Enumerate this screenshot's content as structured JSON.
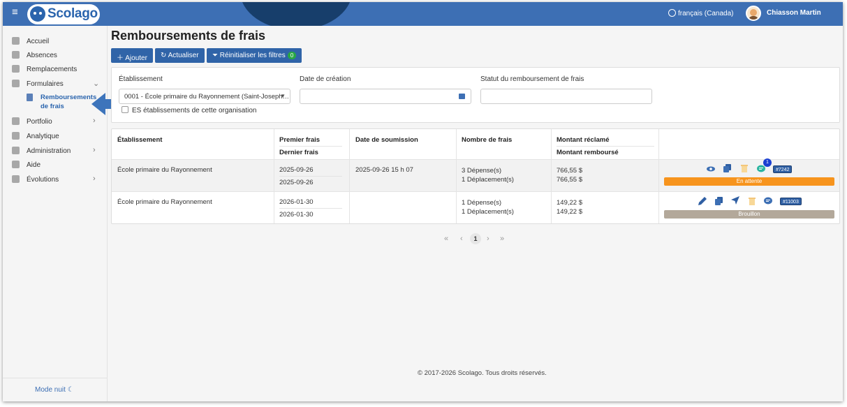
{
  "app": {
    "logo_text": "Scolago",
    "language": "français (Canada)",
    "user_name": "Chiasson Martin"
  },
  "sidebar": {
    "items": [
      {
        "label": "Accueil",
        "icon": "home-icon"
      },
      {
        "label": "Absences",
        "icon": "users-icon"
      },
      {
        "label": "Remplacements",
        "icon": "swap-icon"
      },
      {
        "label": "Formulaires",
        "icon": "document-icon"
      },
      {
        "label": "Portfolio",
        "icon": "trophy-icon"
      },
      {
        "label": "Analytique",
        "icon": "chart-icon"
      },
      {
        "label": "Administration",
        "icon": "gear-icon"
      },
      {
        "label": "Aide",
        "icon": "question-icon"
      },
      {
        "label": "Évolutions",
        "icon": "plant-icon"
      }
    ],
    "sub_item": {
      "label_line1": "Remboursements",
      "label_line2": "de frais"
    },
    "mode_nuit": "Mode nuit"
  },
  "page": {
    "title": "Remboursements de frais",
    "buttons": {
      "add": "Ajouter",
      "refresh": "Actualiser",
      "reset": "Réinitialiser les filtres",
      "reset_count": "0"
    }
  },
  "filters": {
    "etablissement_label": "Établissement",
    "etablissement_value": "0001 - École primaire du Rayonnement (Saint-Joseph…",
    "date_label": "Date de création",
    "date_value": "",
    "statut_label": "Statut du remboursement de frais",
    "statut_value": "",
    "checkbox_label": "ES établissements de cette organisation"
  },
  "table": {
    "headers": {
      "etablissement": "Établissement",
      "premier_frais": "Premier frais",
      "dernier_frais": "Dernier frais",
      "date_soumission": "Date de soumission",
      "nombre_frais": "Nombre de frais",
      "montant_reclame": "Montant réclamé",
      "montant_rembourse": "Montant remboursé"
    },
    "rows": [
      {
        "etablissement": "École primaire du Rayonnement",
        "premier_frais": "2025-09-26",
        "dernier_frais": "2025-09-26",
        "date_soumission": "2025-09-26 15 h 07",
        "depenses": "3 Dépense(s)",
        "deplacements": "1 Déplacement(s)",
        "montant_reclame": "766,55 $",
        "montant_rembourse": "766,55 $",
        "notif_count": "1",
        "number": "#7242",
        "status": "En attente",
        "status_color": "#f7941d"
      },
      {
        "etablissement": "École primaire du Rayonnement",
        "premier_frais": "2026-01-30",
        "dernier_frais": "2026-01-30",
        "date_soumission": "",
        "depenses": "1 Dépense(s)",
        "deplacements": "1 Déplacement(s)",
        "montant_reclame": "149,22 $",
        "montant_rembourse": "149,22 $",
        "number": "#11003",
        "status": "Brouillon",
        "status_color": "#b3a89a"
      }
    ]
  },
  "pagination": {
    "current": "1",
    "first": "«",
    "prev": "‹",
    "next": "›",
    "last": "»"
  },
  "footer": "© 2017-2026 Scolago. Tous droits réservés."
}
